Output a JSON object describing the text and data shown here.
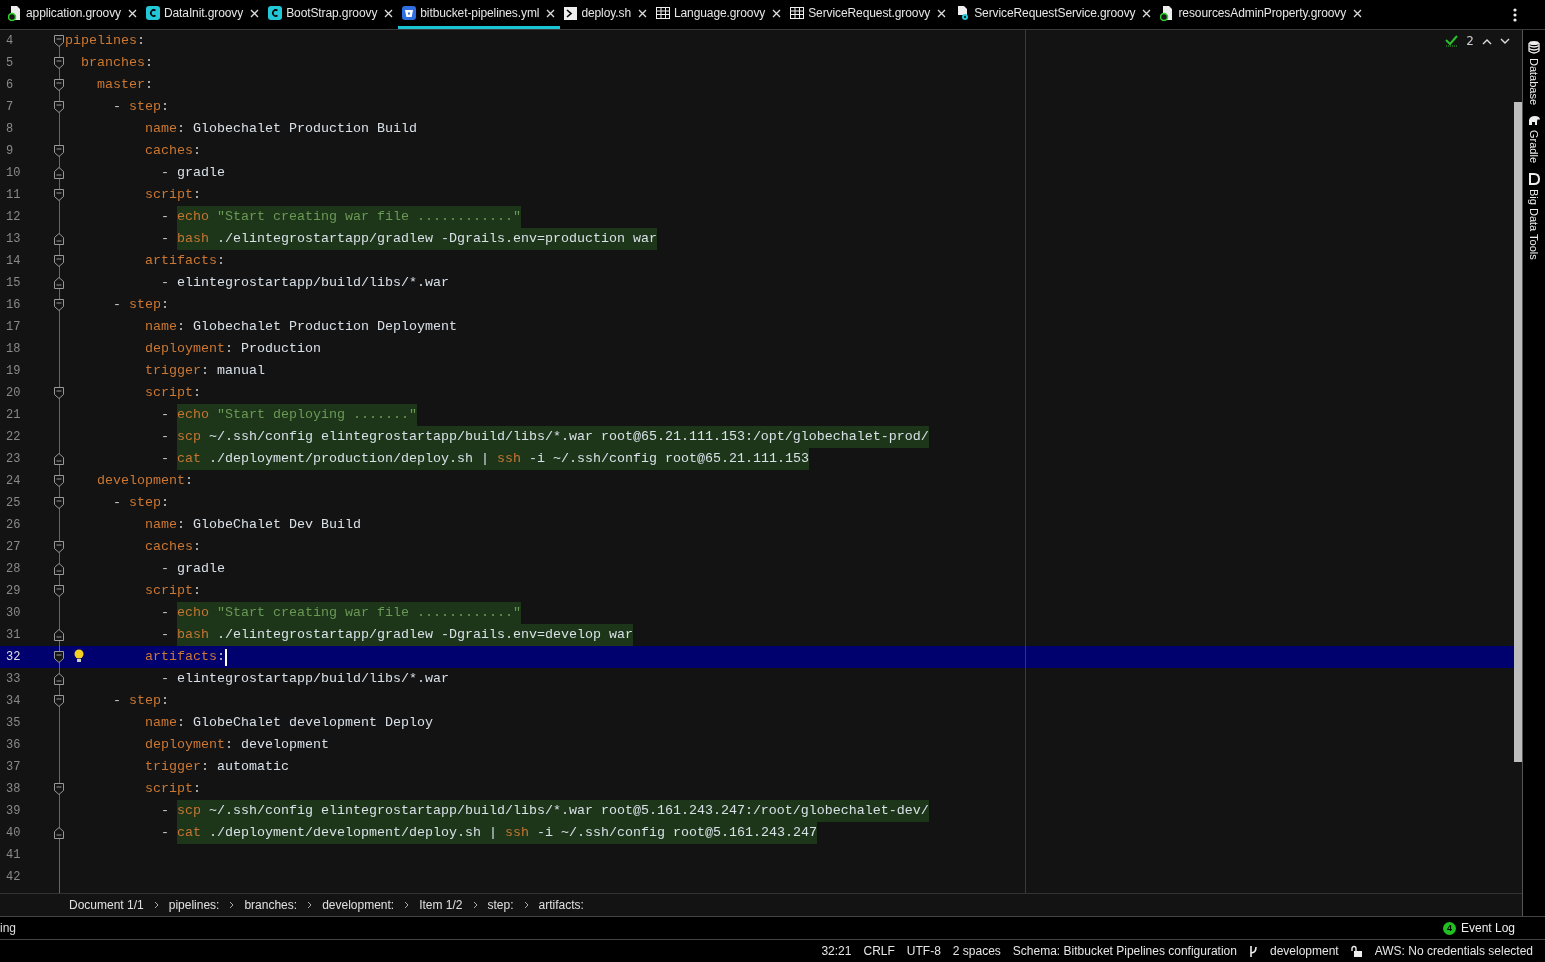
{
  "tabs": [
    {
      "label": "application.groovy",
      "selected": false
    },
    {
      "label": "DataInit.groovy",
      "selected": false
    },
    {
      "label": "BootStrap.groovy",
      "selected": false
    },
    {
      "label": "bitbucket-pipelines.yml",
      "selected": true
    },
    {
      "label": "deploy.sh",
      "selected": false
    },
    {
      "label": "Language.groovy",
      "selected": false
    },
    {
      "label": "ServiceRequest.groovy",
      "selected": false
    },
    {
      "label": "ServiceRequestService.groovy",
      "selected": false
    },
    {
      "label": "resourcesAdminProperty.groovy",
      "selected": false
    }
  ],
  "inspection": {
    "count": "2"
  },
  "editor": {
    "lines": [
      {
        "n": "4",
        "current": false,
        "tokens": [
          {
            "kind": "key",
            "text": "pipelines"
          },
          {
            "kind": "colon",
            "text": ":"
          }
        ],
        "children": [
          {
            "n": "5",
            "current": false,
            "tokens": [
              {
                "kind": "key",
                "text": "branches"
              },
              {
                "kind": "colon",
                "text": ":"
              }
            ],
            "children": [
              {
                "n": "6",
                "current": false,
                "tokens": [
                  {
                    "kind": "key",
                    "text": "master"
                  },
                  {
                    "kind": "colon",
                    "text": ":"
                  }
                ],
                "children": [
                  {
                    "n": "7",
                    "current": false,
                    "tokens": [
                      {
                        "kind": "dash",
                        "text": "- "
                      },
                      {
                        "kind": "key",
                        "text": "step"
                      },
                      {
                        "kind": "colon",
                        "text": ":"
                      }
                    ],
                    "children": [
                      {
                        "n": "8",
                        "current": false,
                        "tokens": [
                          {
                            "kind": "key",
                            "text": "name"
                          },
                          {
                            "kind": "colon",
                            "text": ": "
                          },
                          {
                            "kind": "value",
                            "text": "Globechalet Production Build"
                          }
                        ]
                      },
                      {
                        "n": "9",
                        "current": false,
                        "tokens": [
                          {
                            "kind": "key",
                            "text": "caches"
                          },
                          {
                            "kind": "colon",
                            "text": ":"
                          }
                        ],
                        "children": [
                          {
                            "n": "10",
                            "current": false,
                            "tokens": [
                              {
                                "kind": "dash",
                                "text": "- "
                              },
                              {
                                "kind": "value",
                                "text": "gradle"
                              }
                            ]
                          }
                        ]
                      },
                      {
                        "n": "11",
                        "current": false,
                        "tokens": [
                          {
                            "kind": "key",
                            "text": "script"
                          },
                          {
                            "kind": "colon",
                            "text": ":"
                          }
                        ],
                        "children": [
                          {
                            "n": "12",
                            "current": false,
                            "tokens": [
                              {
                                "kind": "dash",
                                "text": "- "
                              },
                              {
                                "kind": "cmd",
                                "text": "echo "
                              },
                              {
                                "kind": "str",
                                "text": "\"Start creating war file ............\""
                              }
                            ]
                          },
                          {
                            "n": "13",
                            "current": false,
                            "tokens": [
                              {
                                "kind": "dash",
                                "text": "- "
                              },
                              {
                                "kind": "cmd",
                                "text": "bash "
                              },
                              {
                                "kind": "arg",
                                "text": "./elintegrostartapp/gradlew -Dgrails.env=production war"
                              }
                            ]
                          }
                        ]
                      },
                      {
                        "n": "14",
                        "current": false,
                        "tokens": [
                          {
                            "kind": "key",
                            "text": "artifacts"
                          },
                          {
                            "kind": "colon",
                            "text": ":"
                          }
                        ],
                        "children": [
                          {
                            "n": "15",
                            "current": false,
                            "tokens": [
                              {
                                "kind": "dash",
                                "text": "- "
                              },
                              {
                                "kind": "value",
                                "text": "elintegrostartapp/build/libs/*.war"
                              }
                            ]
                          }
                        ]
                      }
                    ]
                  },
                  {
                    "n": "16",
                    "current": false,
                    "tokens": [
                      {
                        "kind": "dash",
                        "text": "- "
                      },
                      {
                        "kind": "key",
                        "text": "step"
                      },
                      {
                        "kind": "colon",
                        "text": ":"
                      }
                    ],
                    "children": [
                      {
                        "n": "17",
                        "current": false,
                        "tokens": [
                          {
                            "kind": "key",
                            "text": "name"
                          },
                          {
                            "kind": "colon",
                            "text": ": "
                          },
                          {
                            "kind": "value",
                            "text": "Globechalet Production Deployment"
                          }
                        ]
                      },
                      {
                        "n": "18",
                        "current": false,
                        "tokens": [
                          {
                            "kind": "key",
                            "text": "deployment"
                          },
                          {
                            "kind": "colon",
                            "text": ": "
                          },
                          {
                            "kind": "value",
                            "text": "Production"
                          }
                        ]
                      },
                      {
                        "n": "19",
                        "current": false,
                        "tokens": [
                          {
                            "kind": "key",
                            "text": "trigger"
                          },
                          {
                            "kind": "colon",
                            "text": ": "
                          },
                          {
                            "kind": "value",
                            "text": "manual"
                          }
                        ]
                      },
                      {
                        "n": "20",
                        "current": false,
                        "tokens": [
                          {
                            "kind": "key",
                            "text": "script"
                          },
                          {
                            "kind": "colon",
                            "text": ":"
                          }
                        ],
                        "children": [
                          {
                            "n": "21",
                            "current": false,
                            "tokens": [
                              {
                                "kind": "dash",
                                "text": "- "
                              },
                              {
                                "kind": "cmd",
                                "text": "echo "
                              },
                              {
                                "kind": "str",
                                "text": "\"Start deploying .......\""
                              }
                            ]
                          },
                          {
                            "n": "22",
                            "current": false,
                            "tokens": [
                              {
                                "kind": "dash",
                                "text": "- "
                              },
                              {
                                "kind": "cmd",
                                "text": "scp "
                              },
                              {
                                "kind": "arg",
                                "text": "~/.ssh/config elintegrostartapp/build/libs/*.war root@65.21.111.153:/opt/globechalet-prod/"
                              }
                            ]
                          },
                          {
                            "n": "23",
                            "current": false,
                            "tokens": [
                              {
                                "kind": "dash",
                                "text": "- "
                              },
                              {
                                "kind": "cmd",
                                "text": "cat "
                              },
                              {
                                "kind": "arg",
                                "text": "./deployment/production/deploy.sh | "
                              },
                              {
                                "kind": "cmd",
                                "text": "ssh "
                              },
                              {
                                "kind": "arg",
                                "text": "-i ~/.ssh/config root@65.21.111.153"
                              }
                            ]
                          }
                        ]
                      }
                    ]
                  }
                ]
              },
              {
                "n": "24",
                "current": false,
                "tokens": [
                  {
                    "kind": "key",
                    "text": "development"
                  },
                  {
                    "kind": "colon",
                    "text": ":"
                  }
                ],
                "children": [
                  {
                    "n": "25",
                    "current": false,
                    "tokens": [
                      {
                        "kind": "dash",
                        "text": "- "
                      },
                      {
                        "kind": "key",
                        "text": "step"
                      },
                      {
                        "kind": "colon",
                        "text": ":"
                      }
                    ],
                    "children": [
                      {
                        "n": "26",
                        "current": false,
                        "tokens": [
                          {
                            "kind": "key",
                            "text": "name"
                          },
                          {
                            "kind": "colon",
                            "text": ": "
                          },
                          {
                            "kind": "value",
                            "text": "GlobeChalet Dev Build"
                          }
                        ]
                      },
                      {
                        "n": "27",
                        "current": false,
                        "tokens": [
                          {
                            "kind": "key",
                            "text": "caches"
                          },
                          {
                            "kind": "colon",
                            "text": ":"
                          }
                        ],
                        "children": [
                          {
                            "n": "28",
                            "current": false,
                            "tokens": [
                              {
                                "kind": "dash",
                                "text": "- "
                              },
                              {
                                "kind": "value",
                                "text": "gradle"
                              }
                            ]
                          }
                        ]
                      },
                      {
                        "n": "29",
                        "current": false,
                        "tokens": [
                          {
                            "kind": "key",
                            "text": "script"
                          },
                          {
                            "kind": "colon",
                            "text": ":"
                          }
                        ],
                        "children": [
                          {
                            "n": "30",
                            "current": false,
                            "tokens": [
                              {
                                "kind": "dash",
                                "text": "- "
                              },
                              {
                                "kind": "cmd",
                                "text": "echo "
                              },
                              {
                                "kind": "str",
                                "text": "\"Start creating war file ............\""
                              }
                            ]
                          },
                          {
                            "n": "31",
                            "current": false,
                            "tokens": [
                              {
                                "kind": "dash",
                                "text": "- "
                              },
                              {
                                "kind": "cmd",
                                "text": "bash "
                              },
                              {
                                "kind": "arg",
                                "text": "./elintegrostartapp/gradlew -Dgrails.env=develop war"
                              }
                            ]
                          }
                        ]
                      },
                      {
                        "n": "32",
                        "current": true,
                        "bulb": true,
                        "tokens": [
                          {
                            "kind": "key",
                            "text": "artifacts"
                          },
                          {
                            "kind": "colon",
                            "text": ":"
                          }
                        ],
                        "children": [
                          {
                            "n": "33",
                            "current": false,
                            "tokens": [
                              {
                                "kind": "dash",
                                "text": "- "
                              },
                              {
                                "kind": "value",
                                "text": "elintegrostartapp/build/libs/*.war"
                              }
                            ]
                          }
                        ]
                      }
                    ]
                  },
                  {
                    "n": "34",
                    "current": false,
                    "tokens": [
                      {
                        "kind": "dash",
                        "text": "- "
                      },
                      {
                        "kind": "key",
                        "text": "step"
                      },
                      {
                        "kind": "colon",
                        "text": ":"
                      }
                    ],
                    "children": [
                      {
                        "n": "35",
                        "current": false,
                        "tokens": [
                          {
                            "kind": "key",
                            "text": "name"
                          },
                          {
                            "kind": "colon",
                            "text": ": "
                          },
                          {
                            "kind": "value",
                            "text": "GlobeChalet development Deploy"
                          }
                        ]
                      },
                      {
                        "n": "36",
                        "current": false,
                        "tokens": [
                          {
                            "kind": "key",
                            "text": "deployment"
                          },
                          {
                            "kind": "colon",
                            "text": ": "
                          },
                          {
                            "kind": "value",
                            "text": "development"
                          }
                        ]
                      },
                      {
                        "n": "37",
                        "current": false,
                        "tokens": [
                          {
                            "kind": "key",
                            "text": "trigger"
                          },
                          {
                            "kind": "colon",
                            "text": ": "
                          },
                          {
                            "kind": "value",
                            "text": "automatic"
                          }
                        ]
                      },
                      {
                        "n": "38",
                        "current": false,
                        "tokens": [
                          {
                            "kind": "key",
                            "text": "script"
                          },
                          {
                            "kind": "colon",
                            "text": ":"
                          }
                        ],
                        "children": [
                          {
                            "n": "39",
                            "current": false,
                            "tokens": [
                              {
                                "kind": "dash",
                                "text": "- "
                              },
                              {
                                "kind": "cmd",
                                "text": "scp "
                              },
                              {
                                "kind": "arg",
                                "text": "~/.ssh/config elintegrostartapp/build/libs/*.war root@5.161.243.247:/root/globechalet-dev/"
                              }
                            ]
                          },
                          {
                            "n": "40",
                            "current": false,
                            "tokens": [
                              {
                                "kind": "dash",
                                "text": "- "
                              },
                              {
                                "kind": "cmd",
                                "text": "cat "
                              },
                              {
                                "kind": "arg",
                                "text": "./deployment/development/deploy.sh | "
                              },
                              {
                                "kind": "cmd",
                                "text": "ssh "
                              },
                              {
                                "kind": "arg",
                                "text": "-i ~/.ssh/config root@5.161.243.247"
                              }
                            ]
                          }
                        ]
                      }
                    ]
                  }
                ]
              }
            ]
          }
        ]
      },
      {
        "n": "41",
        "current": false
      },
      {
        "n": "42",
        "current": false
      }
    ]
  },
  "breadcrumbs": [
    "Document 1/1",
    "pipelines:",
    "branches:",
    "development:",
    "Item 1/2",
    "step:",
    "artifacts:"
  ],
  "side_tools": [
    {
      "label": "Database"
    },
    {
      "label": "Gradle"
    },
    {
      "label": "Big Data Tools"
    }
  ],
  "tool_strip": {
    "left_text": "ing",
    "event_log": {
      "label": "Event Log",
      "count": "4"
    }
  },
  "status_bar": {
    "position": "32:21",
    "line_separator": "CRLF",
    "encoding": "UTF-8",
    "indent": "2 spaces",
    "schema": "Schema: Bitbucket Pipelines configuration",
    "branch": "development",
    "aws": "AWS: No credentials selected"
  }
}
